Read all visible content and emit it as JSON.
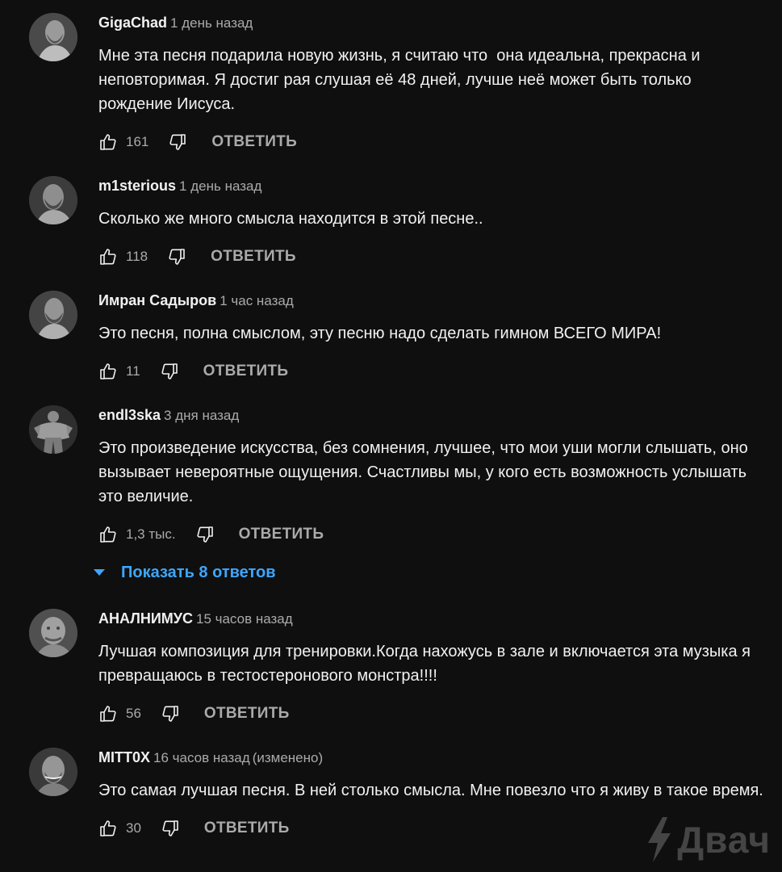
{
  "comments": [
    {
      "author": "GigaChad",
      "time": "1 день назад",
      "edited": "",
      "text": "Мне эта песня подарила новую жизнь, я считаю что  она идеальна, прекрасна и неповторимая. Я достиг рая слушая её 48 дней, лучше неё может быть только рождение Иисуса.",
      "likes": "161",
      "reply": "ОТВЕТИТЬ"
    },
    {
      "author": "m1sterious",
      "time": "1 день назад",
      "edited": "",
      "text": "Сколько же много смысла находится в этой песне..",
      "likes": "118",
      "reply": "ОТВЕТИТЬ"
    },
    {
      "author": "Имран Садыров",
      "time": "1 час назад",
      "edited": "",
      "text": "Это песня, полна смыслом, эту песню надо сделать гимном ВСЕГО МИРА!",
      "likes": "11",
      "reply": "ОТВЕТИТЬ"
    },
    {
      "author": "endl3ska",
      "time": "3 дня назад",
      "edited": "",
      "text": "Это произведение искусства, без сомнения, лучшее, что мои уши могли слышать, оно вызывает невероятные ощущения. Счастливы мы, у кого есть возможность услышать это величие.",
      "likes": "1,3 тыс.",
      "reply": "ОТВЕТИТЬ",
      "show_replies": "Показать 8 ответов"
    },
    {
      "author": "АНАЛНИМУС",
      "time": "15 часов назад",
      "edited": "",
      "text": "Лучшая композиция для тренировки.Когда нахожусь в зале и включается эта музыка я превращаюсь в тестостеронового монстра!!!!",
      "likes": "56",
      "reply": "ОТВЕТИТЬ"
    },
    {
      "author": "MITT0X",
      "time": "16 часов назад",
      "edited": "(изменено)",
      "text": "Это самая лучшая песня. В ней столько смысла. Мне повезло что я живу в такое время.",
      "likes": "30",
      "reply": "ОТВЕТИТЬ"
    }
  ],
  "watermark": {
    "text": "Двач"
  },
  "icons": [
    "like-icon",
    "dislike-icon",
    "caret-down-icon",
    "bolt-icon"
  ],
  "colors": {
    "background": "#0f0f0f",
    "text": "#f1f1f1",
    "secondary": "#aaaaaa",
    "link": "#3ea6ff"
  }
}
